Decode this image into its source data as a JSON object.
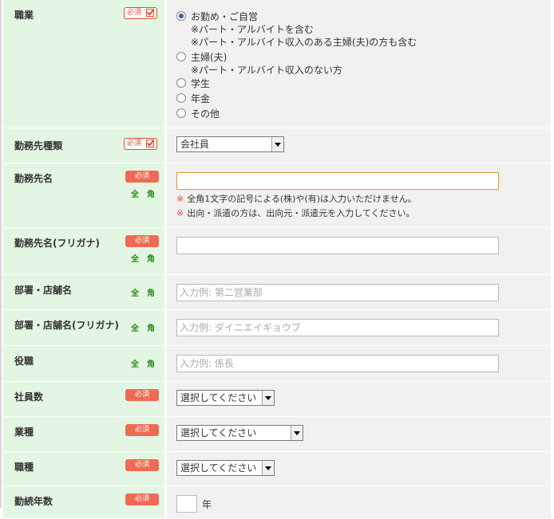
{
  "colors": {
    "label_bg": "#e3f6e3",
    "value_bg": "#f1f1f1",
    "required": "#ef6a55",
    "zenkaku": "#2a8a1e",
    "note_mark": "#e24a36"
  },
  "required_label": "必須",
  "zenkaku_label": "全角",
  "occupation": {
    "label": "職業",
    "options": [
      {
        "label": "お勤め・ご自営",
        "selected": true
      },
      {
        "label": "主婦(夫)",
        "selected": false
      },
      {
        "label": "学生",
        "selected": false
      },
      {
        "label": "年金",
        "selected": false
      },
      {
        "label": "その他",
        "selected": false
      }
    ],
    "notes_employed": [
      "※パート・アルバイトを含む",
      "※パート・アルバイト収入のある主婦(夫)の方も含む"
    ],
    "notes_housewife": [
      "※パート・アルバイト収入のない方"
    ]
  },
  "employer_type": {
    "label": "勤務先種類",
    "value": "会社員"
  },
  "employer_name": {
    "label": "勤務先名",
    "value": "",
    "warnings": [
      "全角1文字の記号による(株)や(有)は入力いただけません。",
      "出向・派遣の方は、出向元・派遣元を入力してください。"
    ],
    "warning_mark": "※"
  },
  "employer_kana": {
    "label": "勤務先名(フリガナ)",
    "value": ""
  },
  "department": {
    "label": "部署・店舗名",
    "placeholder": "入力例: 第二営業部"
  },
  "department_kana": {
    "label": "部署・店舗名(フリガナ)",
    "placeholder": "入力例: ダイニエイギョウブ"
  },
  "position": {
    "label": "役職",
    "placeholder": "入力例: 係長"
  },
  "employees": {
    "label": "社員数",
    "value": "選択してください"
  },
  "industry": {
    "label": "業種",
    "value": "選択してください"
  },
  "job_type": {
    "label": "職種",
    "value": "選択してください"
  },
  "years_employed": {
    "label": "勤続年数",
    "unit": "年"
  }
}
